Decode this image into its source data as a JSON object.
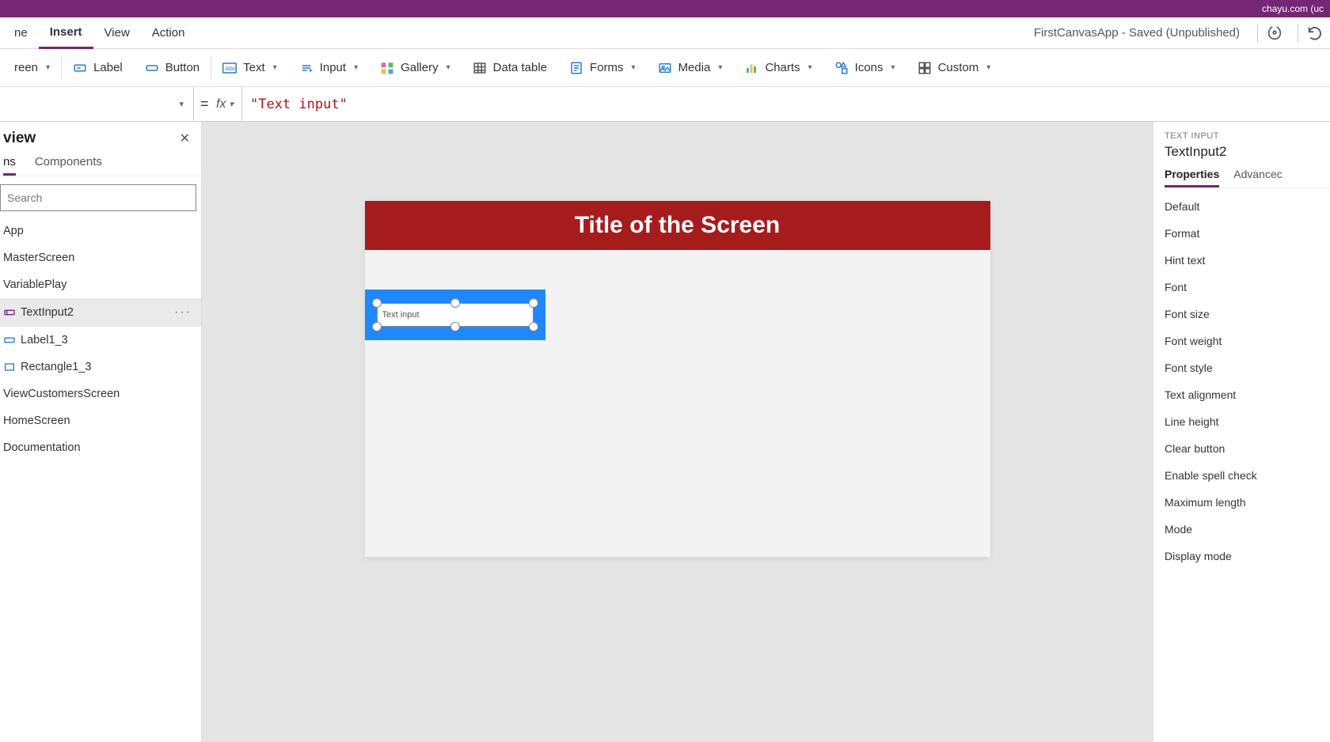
{
  "titlebar": {
    "account_hint": "chayu.com (uc"
  },
  "menu": {
    "items": [
      "ne",
      "Insert",
      "View",
      "Action"
    ],
    "active_index": 1,
    "app_title": "FirstCanvasApp - Saved (Unpublished)"
  },
  "ribbon": {
    "screen": "reen",
    "label": "Label",
    "button": "Button",
    "text": "Text",
    "input": "Input",
    "gallery": "Gallery",
    "datatable": "Data table",
    "forms": "Forms",
    "media": "Media",
    "charts": "Charts",
    "icons": "Icons",
    "custom": "Custom"
  },
  "formula": {
    "eq": "=",
    "fx": "fx",
    "value": "\"Text input\""
  },
  "tree": {
    "title": "view",
    "tabs": [
      "ns",
      "Components"
    ],
    "search_placeholder": "Search",
    "items": [
      {
        "label": "App"
      },
      {
        "label": "MasterScreen"
      },
      {
        "label": "VariablePlay"
      },
      {
        "label": "TextInput2",
        "selected": true,
        "icon": "textinput"
      },
      {
        "label": "Label1_3",
        "icon": "label"
      },
      {
        "label": "Rectangle1_3",
        "icon": "rect"
      },
      {
        "label": "ViewCustomersScreen"
      },
      {
        "label": "HomeScreen"
      },
      {
        "label": "Documentation"
      }
    ]
  },
  "canvas": {
    "screen_title": "Title of the Screen",
    "control_text": "Text input"
  },
  "props": {
    "type_label": "TEXT INPUT",
    "control_name": "TextInput2",
    "tabs": [
      "Properties",
      "Advancec"
    ],
    "rows": [
      "Default",
      "Format",
      "Hint text",
      "Font",
      "Font size",
      "Font weight",
      "Font style",
      "Text alignment",
      "Line height",
      "Clear button",
      "Enable spell check",
      "Maximum length",
      "Mode",
      "Display mode"
    ]
  }
}
